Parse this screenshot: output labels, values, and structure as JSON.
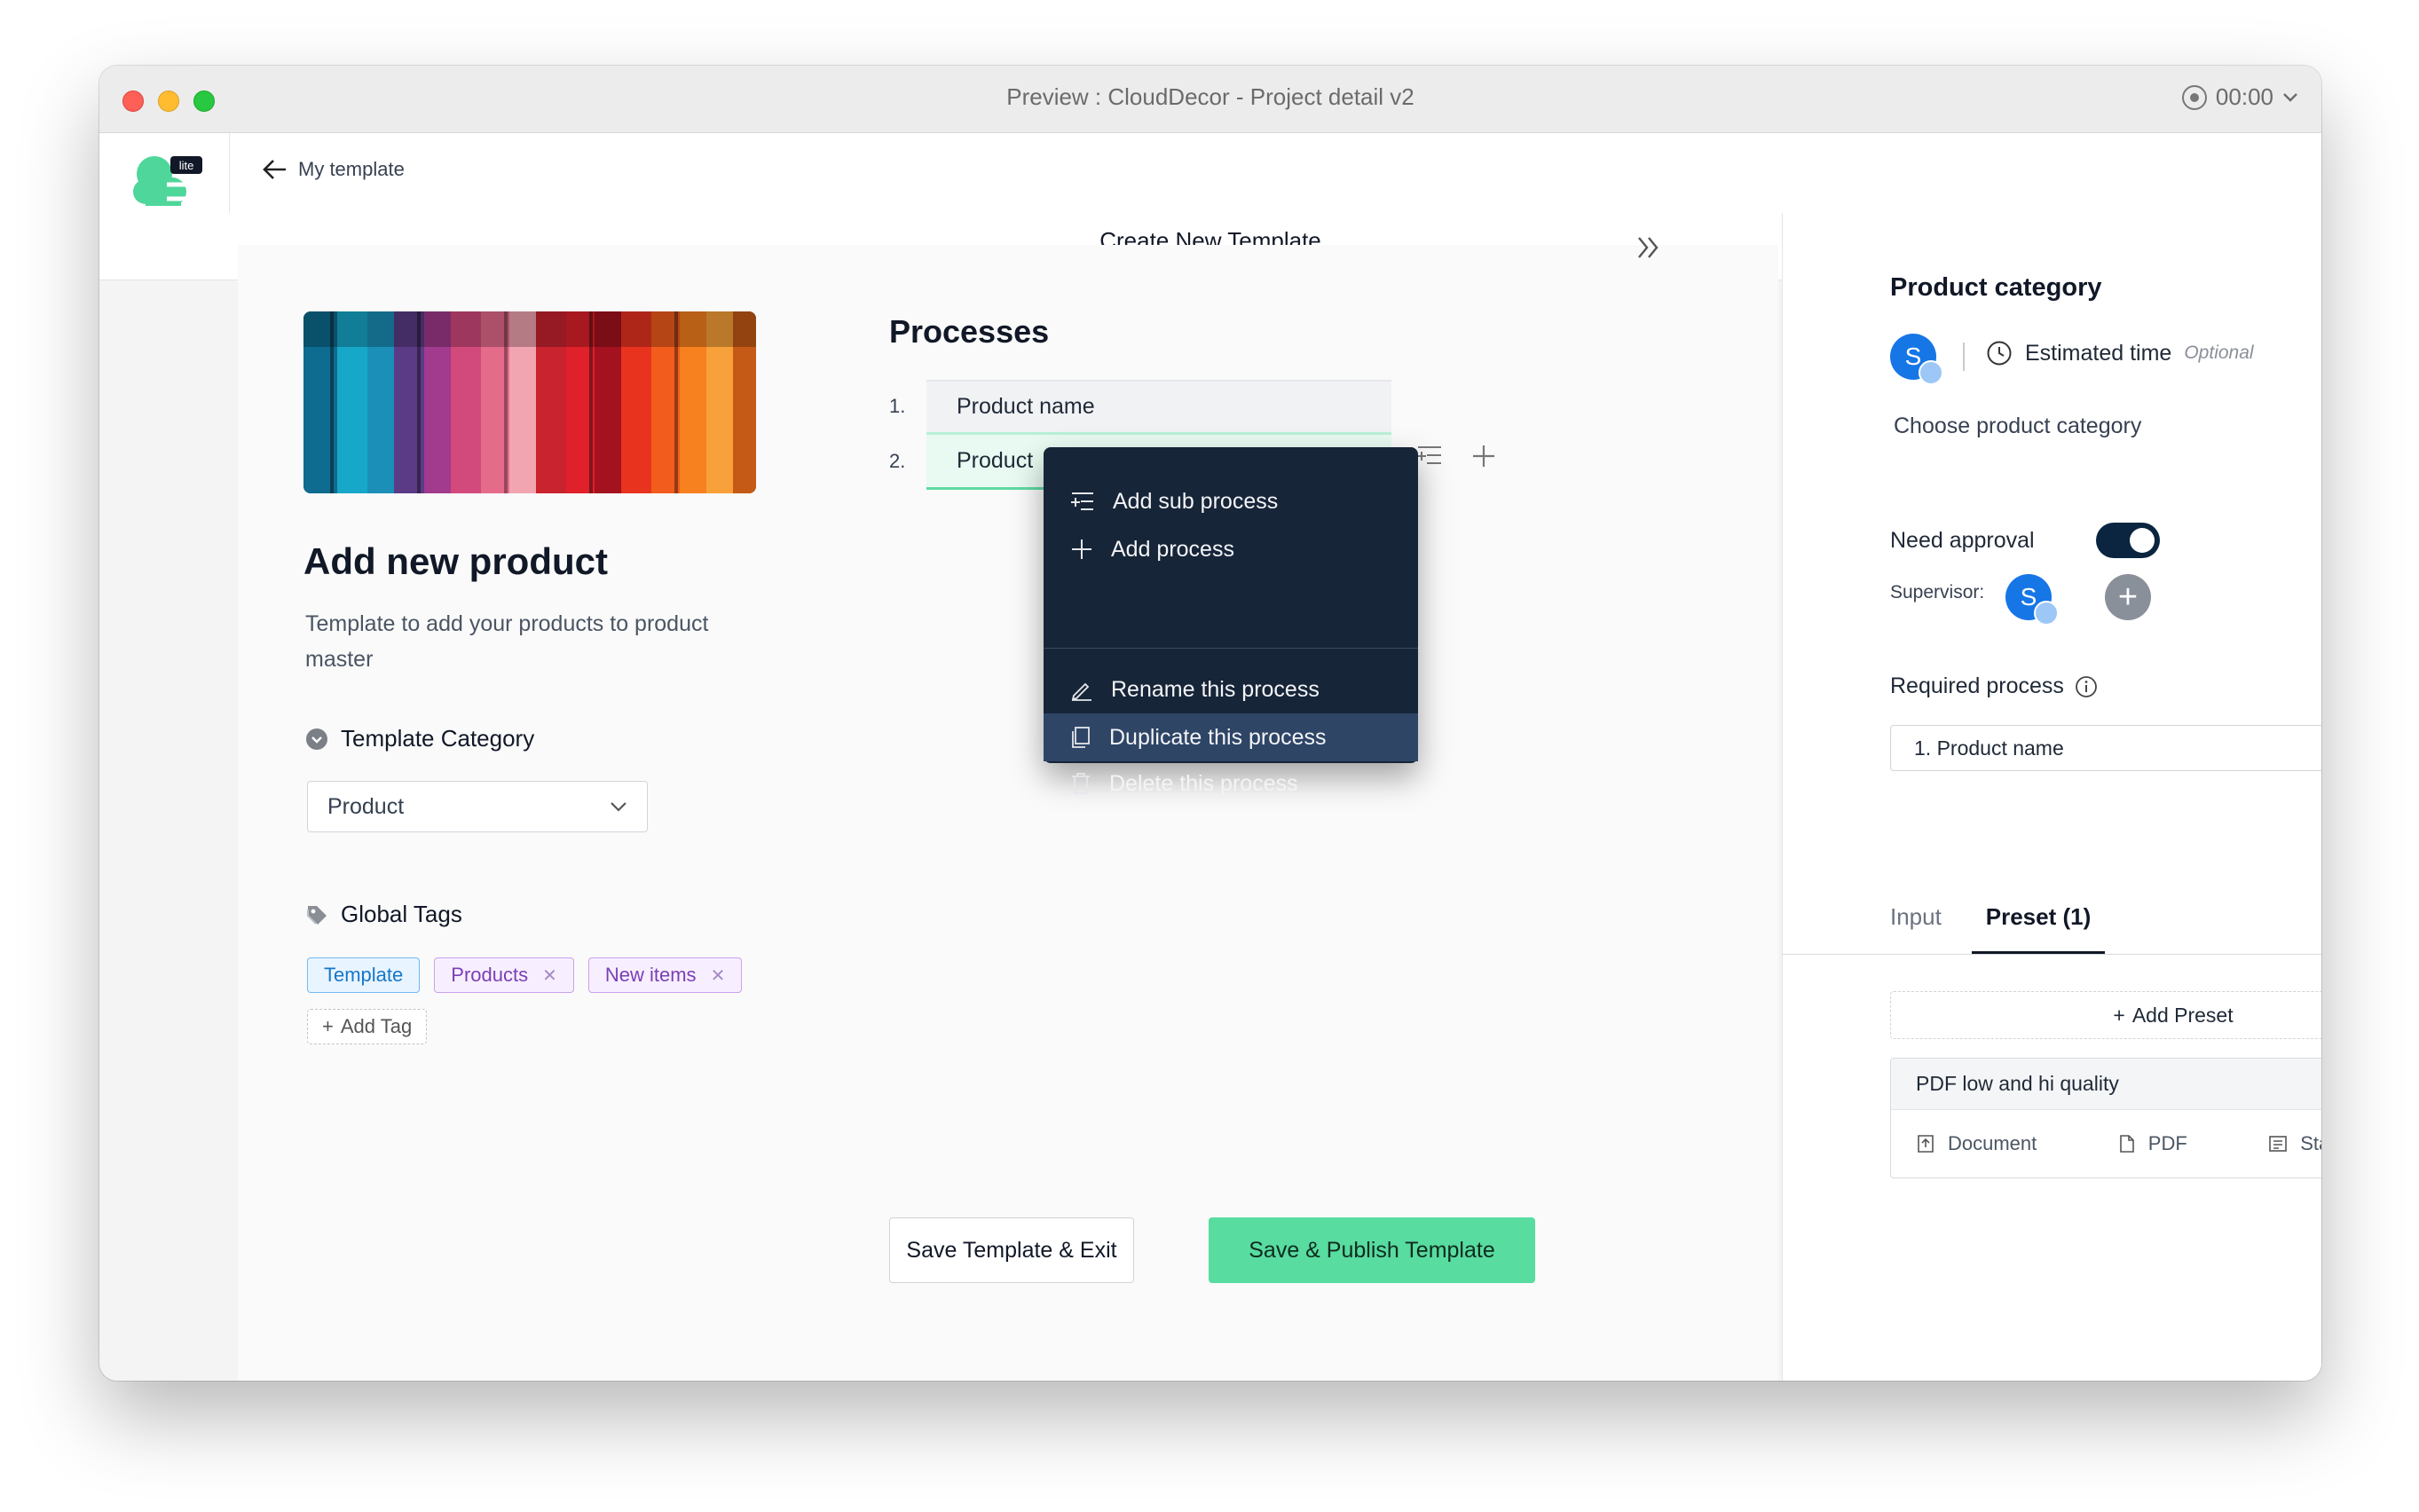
{
  "window": {
    "title": "Preview : CloudDecor - Project detail v2",
    "timer": "00:00"
  },
  "header": {
    "logo_badge": "lite",
    "back_label": "My template",
    "page_title": "Create New Template"
  },
  "template": {
    "title": "Add new product",
    "description": "Template to add your products to product master",
    "category_label": "Template Category",
    "category_value": "Product",
    "tags_label": "Global Tags",
    "tags": [
      "Template",
      "Products",
      "New items"
    ],
    "add_tag_label": "Add Tag"
  },
  "processes": {
    "title": "Processes",
    "items": [
      {
        "number": "1.",
        "name": "Product name"
      },
      {
        "number": "2.",
        "name": "Product"
      }
    ]
  },
  "context_menu": {
    "items": [
      "Add sub process",
      "Add process",
      "Rename this process",
      "Duplicate this process",
      "Delete this process"
    ],
    "highlighted": "Duplicate this process"
  },
  "actions": {
    "save_exit": "Save Template & Exit",
    "save_publish": "Save & Publish Template"
  },
  "right_panel": {
    "title": "Product category",
    "assignee_initial": "S",
    "estimated_time_label": "Estimated time",
    "optional_label": "Optional",
    "instruction": "Choose product category",
    "need_approval_label": "Need approval",
    "need_approval_on": true,
    "supervisor_label": "Supervisor:",
    "supervisor_initial": "S",
    "required_process_label": "Required process",
    "required_process_value": "1. Product name",
    "tabs": [
      "Input",
      "Preset (1)"
    ],
    "active_tab": "Preset (1)",
    "add_preset_label": "Add Preset",
    "preset": {
      "name": "PDF low and hi quality",
      "type": "Document",
      "format": "PDF",
      "quality": "Standard, Print"
    }
  },
  "colors": {
    "accent_green": "#58dca0",
    "menu_bg": "#172539",
    "toggle_on": "#0b2540",
    "avatar_blue": "#1676e6"
  }
}
